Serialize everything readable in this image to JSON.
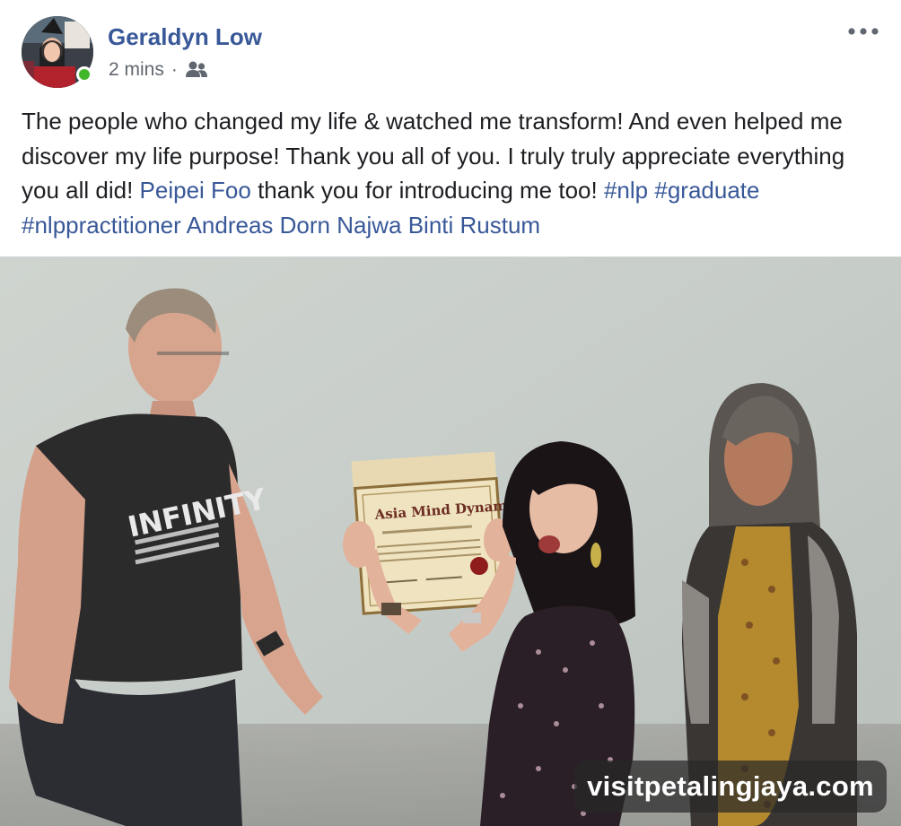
{
  "post": {
    "author_name": "Geraldyn Low",
    "timestamp": "2 mins",
    "separator": "·",
    "audience_icon": "friends-icon",
    "more_icon": "ellipsis-icon",
    "text": {
      "part1": "The people who changed my life & watched me transform! And even helped me discover my life purpose! Thank you all of you. I truly truly appreciate everything you all did! ",
      "mention1": "Peipei Foo",
      "part2": " thank you for introducing me too! ",
      "hashtag1": "#nlp",
      "hashtag2": "#graduate",
      "hashtag3": "#nlppractitioner",
      "mention2": "Andreas Dorn",
      "mention3": "Najwa Binti Rustum"
    },
    "photo": {
      "certificate_title": "Asia Mind Dynamics",
      "shirt_text": "INFINITY",
      "watermark": "visitpetalingjaya.com"
    }
  },
  "colors": {
    "link": "#385898",
    "text": "#1c1e21",
    "meta": "#616770",
    "online": "#42b72a"
  }
}
